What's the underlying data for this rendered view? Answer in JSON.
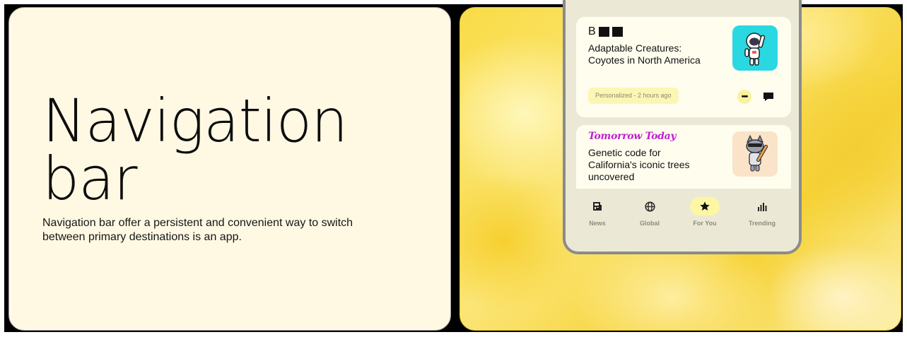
{
  "hero": {
    "title_line1": "Navigation",
    "title_line2": "bar",
    "description": "Navigation bar offer a persistent and convenient way to switch between primary destinations is an app."
  },
  "feed": {
    "cards": [
      {
        "source": "B",
        "headline": "Adaptable Creatures: Coyotes in North America",
        "meta": "Personalized - 2 hours ago",
        "more_icon": "ellipsis-icon",
        "comment_icon": "comment-icon",
        "thumbnail": "astronaut-illustration"
      },
      {
        "source": "Tomorrow Today",
        "headline": "Genetic code for California's iconic trees uncovered",
        "thumbnail": "cat-with-bat-illustration"
      }
    ]
  },
  "navbar": {
    "items": [
      {
        "label": "News",
        "icon": "newspaper-icon",
        "active": false
      },
      {
        "label": "Global",
        "icon": "globe-icon",
        "active": false
      },
      {
        "label": "For You",
        "icon": "star-icon",
        "active": true
      },
      {
        "label": "Trending",
        "icon": "trending-bars-icon",
        "active": false
      }
    ]
  },
  "colors": {
    "left_background": "#fff9e3",
    "phone_background": "#ebe9d6",
    "card_background": "#fffdee",
    "active_indicator": "#fdf6a4",
    "source_magenta": "#c020d0",
    "astronaut_tile": "#2ad8e2"
  }
}
